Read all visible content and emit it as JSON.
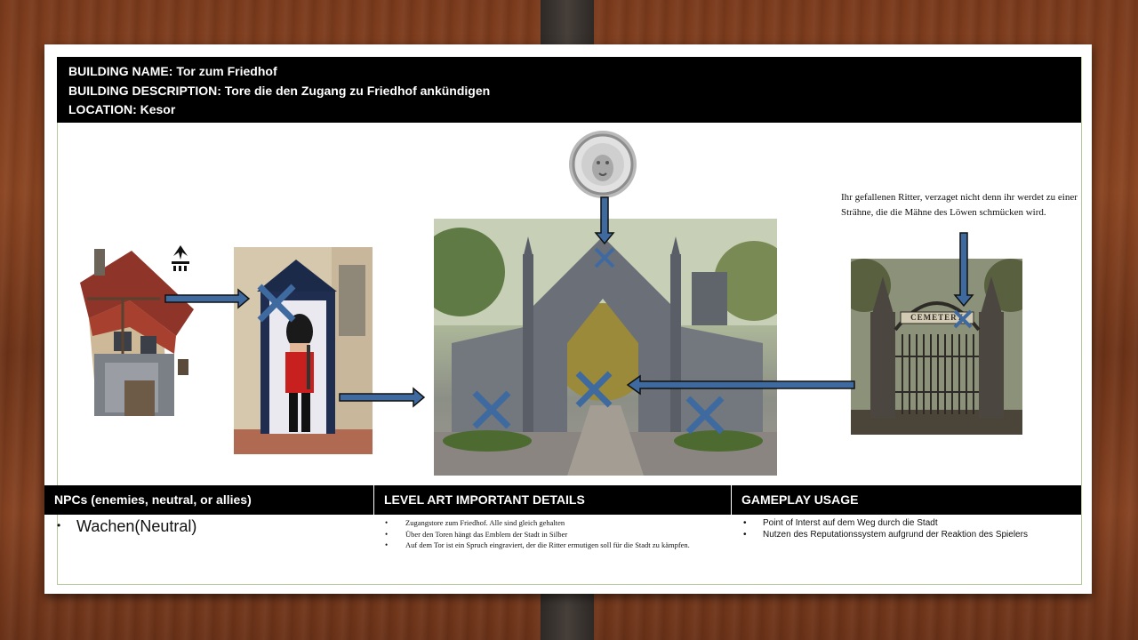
{
  "header": {
    "line1": "BUILDING NAME: Tor zum Friedhof",
    "line2": "BUILDING DESCRIPTION: Tore die den Zugang zu Friedhof ankündigen",
    "line3": "LOCATION: Kesor"
  },
  "quote": "Ihr gefallenen Ritter, verzaget nicht denn ihr werdet zu einer Strähne, die die Mähne des Löwen schmücken wird.",
  "cemetery_sign": "CEMETERY",
  "table": {
    "npcs": {
      "heading": "NPCs (enemies, neutral, or allies)",
      "items": [
        "Wachen(Neutral)"
      ]
    },
    "level_art": {
      "heading": "LEVEL ART IMPORTANT DETAILS",
      "items": [
        "Zugangstore zum Friedhof. Alle sind gleich gehalten",
        "Über den Toren hängt das Emblem der Stadt in Silber",
        "Auf dem Tor ist ein Spruch eingraviert, der die Ritter ermutigen soll für die Stadt zu kämpfen."
      ]
    },
    "gameplay": {
      "heading": "GAMEPLAY USAGE",
      "items": [
        "Point of Interst auf dem Weg durch die Stadt",
        "Nutzen des Reputationssystem aufgrund der Reaktion des Spielers"
      ]
    }
  },
  "colors": {
    "accent_blue": "#3f6aa0",
    "header_bg": "#000000"
  }
}
